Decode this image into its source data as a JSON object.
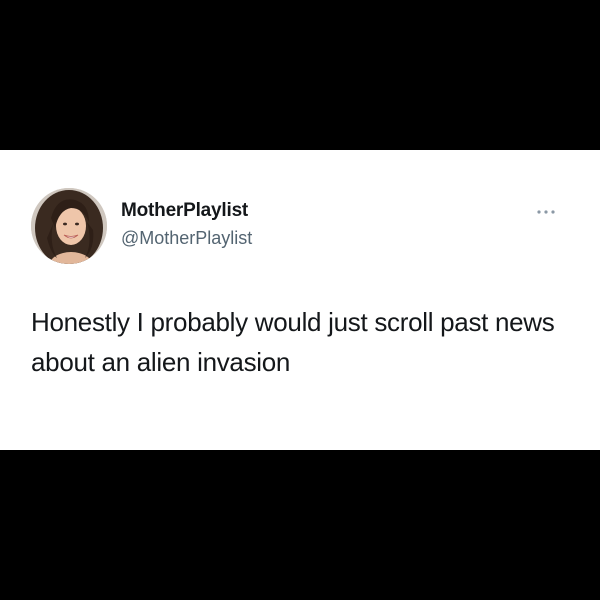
{
  "tweet": {
    "display_name": "MotherPlaylist",
    "handle": "@MotherPlaylist",
    "text": "Honestly I probably would just scroll past news about an alien invasion",
    "avatar_icon": "profile-photo-icon",
    "more_icon": "more-options-icon"
  },
  "colors": {
    "background": "#000000",
    "card": "#ffffff",
    "text_primary": "#14171a",
    "text_secondary": "#536471"
  }
}
